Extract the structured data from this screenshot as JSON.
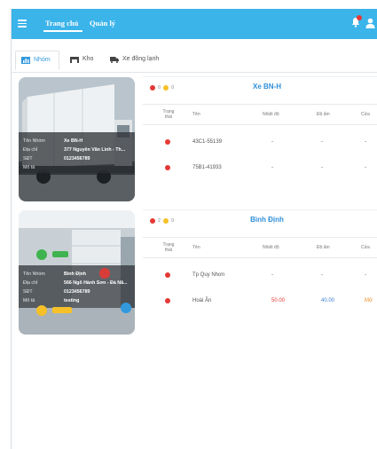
{
  "nav": {
    "home": "Trang chủ",
    "manage": "Quản lý"
  },
  "tabs": [
    {
      "label": "Nhóm"
    },
    {
      "label": "Kho"
    },
    {
      "label": "Xe đông lạnh"
    }
  ],
  "colors": {
    "topbar": "#3bb4ea",
    "title": "#2f8fd8",
    "alarm_red": "#e53935",
    "alarm_yellow": "#f6c028"
  },
  "cards": [
    {
      "title": "Xe BN-H",
      "status_counts": {
        "red": "0",
        "yellow": "0"
      },
      "info": [
        {
          "key": "Tên Nhóm",
          "value": "Xe BN-H"
        },
        {
          "key": "Địa chỉ",
          "value": "377 Nguyễn Văn Linh - Th..."
        },
        {
          "key": "SĐT",
          "value": "0123456789"
        },
        {
          "key": "Mô tả",
          "value": ""
        }
      ],
      "columns": [
        "Trạng thái",
        "Tên",
        "Nhiệt độ",
        "Độ ẩm",
        "Cửa"
      ],
      "rows": [
        {
          "name": "43C1-55139",
          "temp": "-",
          "hum": "-",
          "door": "-"
        },
        {
          "name": "75B1-41933",
          "temp": "-",
          "hum": "-",
          "door": "-"
        }
      ]
    },
    {
      "title": "Bình Định",
      "status_counts": {
        "red": "2",
        "yellow": "0"
      },
      "info": [
        {
          "key": "Tên Nhóm",
          "value": "Bình Định"
        },
        {
          "key": "Địa chỉ",
          "value": "566 Ngô Hành Sơn - Đà Nẵ..."
        },
        {
          "key": "SĐT",
          "value": "0123456789"
        },
        {
          "key": "Mô tả",
          "value": "testing"
        }
      ],
      "columns": [
        "Trạng thái",
        "Tên",
        "Nhiệt độ",
        "Độ ẩm",
        "Cửa"
      ],
      "rows": [
        {
          "name": "Tp Quy Nhơn",
          "temp": "-",
          "hum": "-",
          "door": "-"
        },
        {
          "name": "Hoài Ân",
          "temp": "50.00",
          "hum": "40.00",
          "door": "Mở"
        }
      ]
    }
  ]
}
